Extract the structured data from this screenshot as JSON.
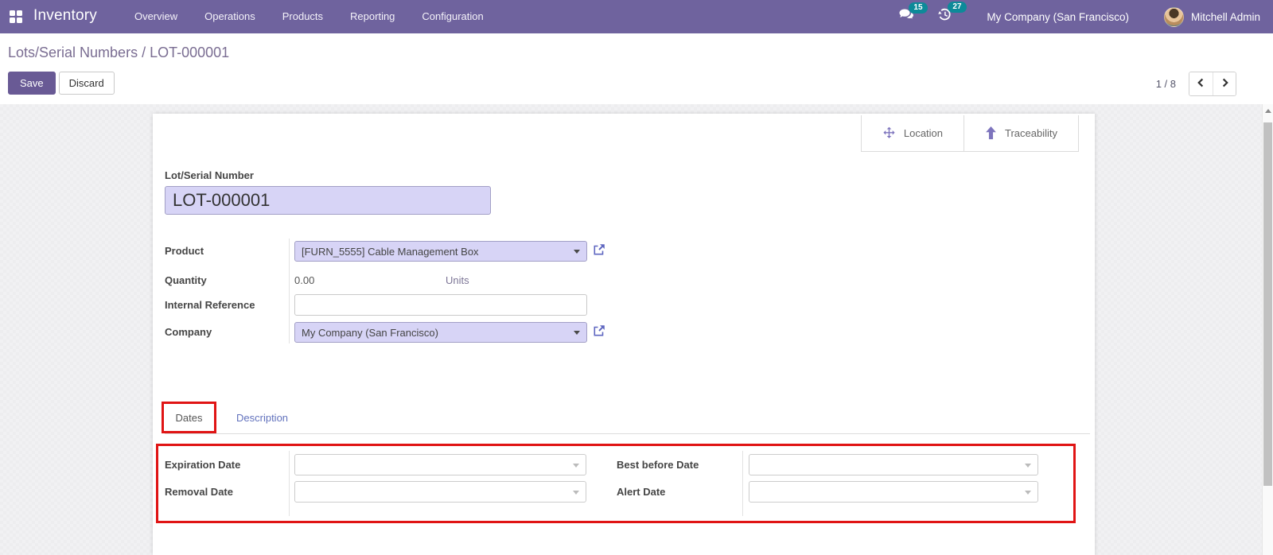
{
  "navbar": {
    "app_name": "Inventory",
    "menu_items": [
      "Overview",
      "Operations",
      "Products",
      "Reporting",
      "Configuration"
    ],
    "messages_badge": "15",
    "activities_badge": "27",
    "company": "My Company (San Francisco)",
    "user_name": "Mitchell Admin"
  },
  "control_panel": {
    "breadcrumb": {
      "parent": "Lots/Serial Numbers",
      "separator": " / ",
      "current": "LOT-000001"
    },
    "save_label": "Save",
    "discard_label": "Discard",
    "pager_value": "1 / 8"
  },
  "form": {
    "stat_buttons": {
      "location": {
        "label": "Location",
        "icon": "move-arrows-icon"
      },
      "traceability": {
        "label": "Traceability",
        "icon": "arrow-up-icon"
      }
    },
    "lot_field": {
      "label": "Lot/Serial Number",
      "value": "LOT-000001"
    },
    "product": {
      "label": "Product",
      "value": "[FURN_5555] Cable Management Box"
    },
    "quantity": {
      "label": "Quantity",
      "value": "0.00",
      "uom": "Units"
    },
    "internal_reference": {
      "label": "Internal Reference",
      "value": ""
    },
    "company": {
      "label": "Company",
      "value": "My Company (San Francisco)"
    },
    "tabs": {
      "dates": "Dates",
      "description": "Description"
    },
    "dates_page": {
      "expiration": {
        "label": "Expiration Date",
        "value": ""
      },
      "best_before": {
        "label": "Best before Date",
        "value": ""
      },
      "removal": {
        "label": "Removal Date",
        "value": ""
      },
      "alert": {
        "label": "Alert Date",
        "value": ""
      }
    }
  },
  "colors": {
    "navbar_bg": "#6f639e",
    "badge_teal": "#0d8a99",
    "accent_purple": "#695a95",
    "field_highlight_bg": "#d7d4f6",
    "annotation_red": "#e01414"
  }
}
